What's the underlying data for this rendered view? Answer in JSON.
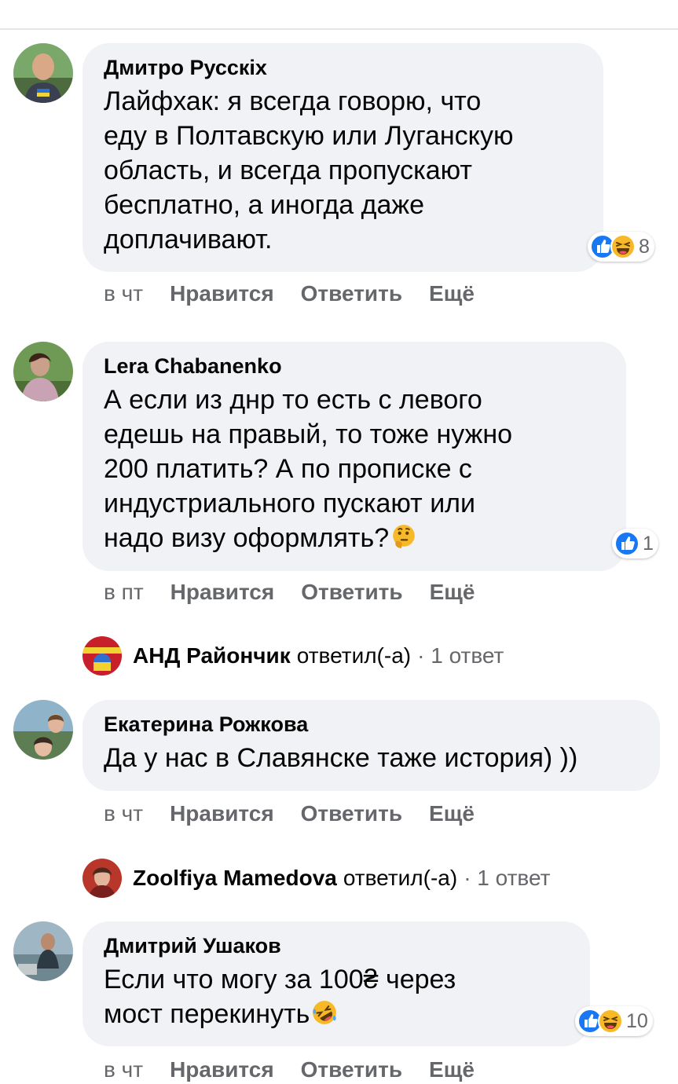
{
  "comments": [
    {
      "author": "Дмитро Русскіх",
      "lines": [
        "Лайфхак: я всегда говорю, что",
        "еду в Полтавскую или Луганскую",
        "область, и всегда пропускают",
        "бесплатно, а иногда даже",
        "доплачивают."
      ],
      "time": "в чт",
      "reactions": {
        "icons": [
          "like-icon",
          "haha-icon"
        ],
        "count": "8"
      }
    },
    {
      "author": "Lera Chabanenko",
      "lines": [
        "А если из днр то есть с левого",
        "едешь на правый, то тоже нужно",
        "200 платить? А по прописке с",
        "индустриального пускают или",
        "надо визу оформлять?"
      ],
      "inline_emoji": "thinking-face-emoji",
      "time": "в пт",
      "reactions": {
        "icons": [
          "like-icon"
        ],
        "count": "1"
      },
      "reply": {
        "name": "АНД Райончик",
        "verb": "ответил(-а)",
        "count": "· 1 ответ"
      }
    },
    {
      "author": "Екатерина Рожкова",
      "lines": [
        "Да у нас в Славянске таже история) ))"
      ],
      "time": "в чт",
      "reply": {
        "name": "Zoolfiya Mamedova",
        "verb": "ответил(-а)",
        "count": "· 1 ответ"
      }
    },
    {
      "author": "Дмитрий Ушаков",
      "lines": [
        "Если что могу за 100₴ через",
        "мост перекинуть"
      ],
      "inline_emoji": "rolling-laughing-emoji",
      "time": "в чт",
      "reactions": {
        "icons": [
          "like-icon",
          "haha-icon"
        ],
        "count": "10"
      }
    }
  ],
  "actions": {
    "like": "Нравится",
    "reply": "Ответить",
    "more": "Ещё"
  },
  "colors": {
    "like_blue": "#1877f2",
    "haha_yellow": "#f7b928",
    "bubble": "#f0f2f5",
    "meta_gray": "#65676b"
  }
}
